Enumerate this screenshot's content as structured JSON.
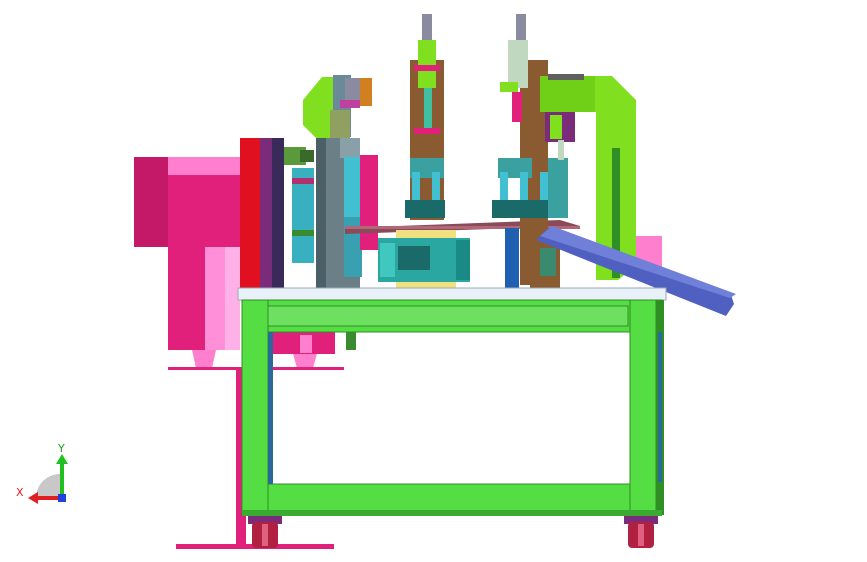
{
  "viewport": {
    "name": "cad-3d-viewport",
    "background": "#ffffff"
  },
  "triad": {
    "x_label": "X",
    "y_label": "Y",
    "x_color": "#e02020",
    "y_color": "#20c020",
    "z_color": "#2040e0"
  },
  "colors": {
    "frame_green": "#55dd44",
    "frame_green_dark": "#2f8f25",
    "table_top": "#e8f0f8",
    "hopper_magenta": "#e0207a",
    "hopper_light": "#ff7fcf",
    "red_panel": "#e01020",
    "purple_panel": "#7a2b7a",
    "motor_cyan": "#2aa7a0",
    "gray_steel": "#6a7f86",
    "brown_column": "#8a5a30",
    "ramp_blue": "#5060c0",
    "lime_arm": "#80e020",
    "yellow_block": "#f0e080",
    "caster_red": "#b02040"
  }
}
